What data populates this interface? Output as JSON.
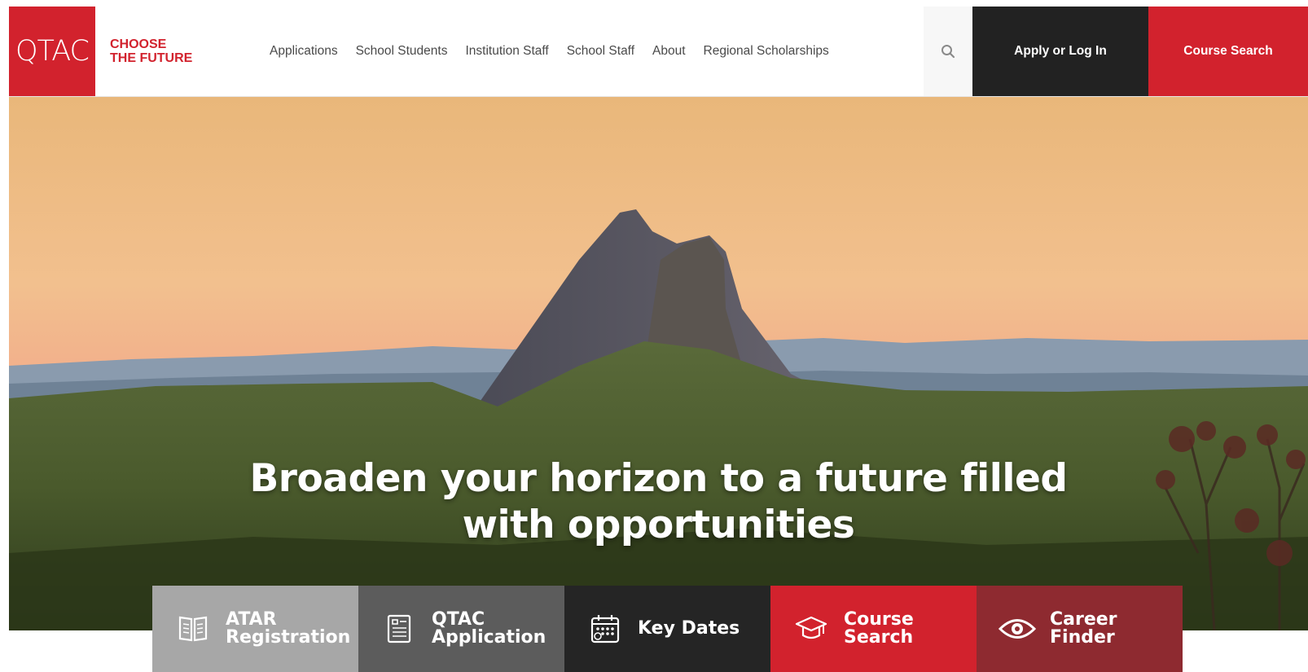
{
  "header": {
    "logo": "QTAC",
    "tagline": [
      "CHOOSE",
      "THE FUTURE"
    ],
    "nav": [
      "Applications",
      "School Students",
      "Institution Staff",
      "School Staff",
      "About",
      "Regional Scholarships"
    ],
    "search_icon": "search-icon",
    "apply_label": "Apply or Log In",
    "course_search_label": "Course Search"
  },
  "hero": {
    "headline_line1": "Broaden your horizon to a future filled",
    "headline_line2": "with opportunities"
  },
  "tiles": [
    {
      "line1": "ATAR",
      "line2": "Registration",
      "icon": "book-icon",
      "color": "#a7a7a7"
    },
    {
      "line1": "QTAC",
      "line2": "Application",
      "icon": "form-icon",
      "color": "#5c5c5c"
    },
    {
      "line1": "Key Dates",
      "line2": "",
      "icon": "calendar-icon",
      "color": "#252525"
    },
    {
      "line1": "Course",
      "line2": "Search",
      "icon": "graduation-cap-icon",
      "color": "#d2222d"
    },
    {
      "line1": "Career",
      "line2": "Finder",
      "icon": "eye-icon",
      "color": "#8e2a30"
    }
  ],
  "colors": {
    "brand_red": "#d2222d",
    "dark": "#222222"
  }
}
